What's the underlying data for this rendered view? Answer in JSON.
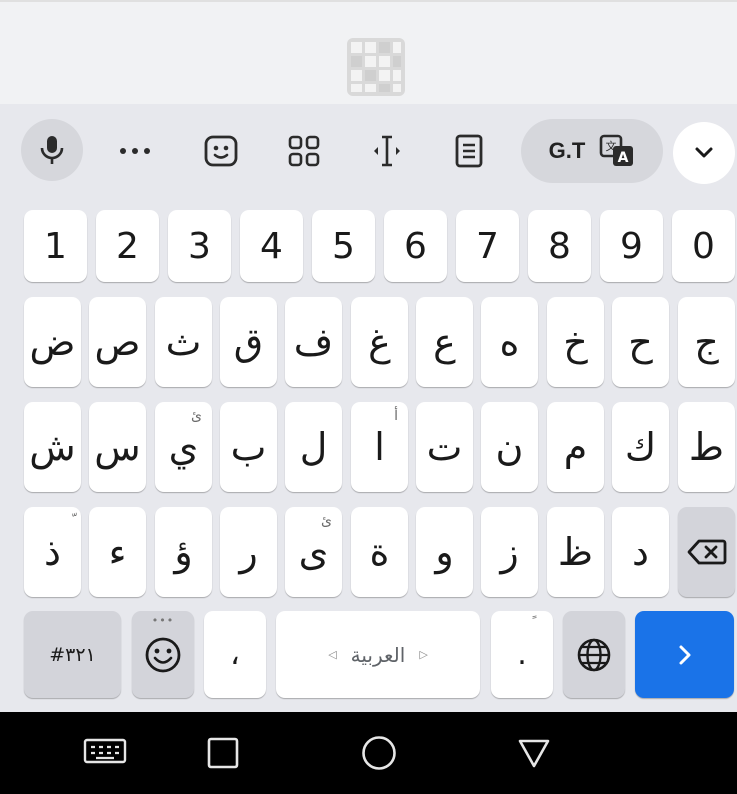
{
  "app": {
    "logo_icon": "crossword-grid-icon"
  },
  "toolbar": {
    "items": [
      "mic-icon",
      "more-dots-icon",
      "sticker-icon",
      "clipboard-grid-icon",
      "text-cursor-icon",
      "notes-icon"
    ],
    "translate_label": "G.T",
    "translate_icon": "translate-icon",
    "collapse_icon": "chevron-down-icon"
  },
  "rows": {
    "numbers": [
      "1",
      "2",
      "3",
      "4",
      "5",
      "6",
      "7",
      "8",
      "9",
      "0"
    ],
    "row1": [
      "ض",
      "ص",
      "ث",
      "ق",
      "ف",
      "غ",
      "ع",
      "ه",
      "خ",
      "ح",
      "ج"
    ],
    "row2": [
      "ش",
      "س",
      "ي",
      "ب",
      "ل",
      "ا",
      "ت",
      "ن",
      "م",
      "ك",
      "ط"
    ],
    "row2_hints": {
      "2": "ئ",
      "5": "أ"
    },
    "row3": [
      "ذ",
      "ء",
      "ؤ",
      "ر",
      "ى",
      "ة",
      "و",
      "ز",
      "ظ",
      "د"
    ],
    "row3_hints": {
      "0": "ّ",
      "4": "ئ"
    }
  },
  "bottom": {
    "symbols_label": "#٣٢١",
    "comma": "،",
    "space_label": "العربية",
    "period": ".",
    "period_hint": "ً",
    "emoji_icon": "emoji-smile-icon",
    "globe_icon": "globe-icon",
    "enter_icon": "arrow-right-icon",
    "backspace_icon": "backspace-icon"
  },
  "nav": [
    "keyboard-switch-icon",
    "recents-square-icon",
    "home-circle-icon",
    "back-triangle-icon"
  ],
  "colors": {
    "accent": "#1a73e8",
    "keyboard_bg": "#e7e8ed",
    "key_bg": "#ffffff",
    "function_key_bg": "#d3d4da"
  }
}
